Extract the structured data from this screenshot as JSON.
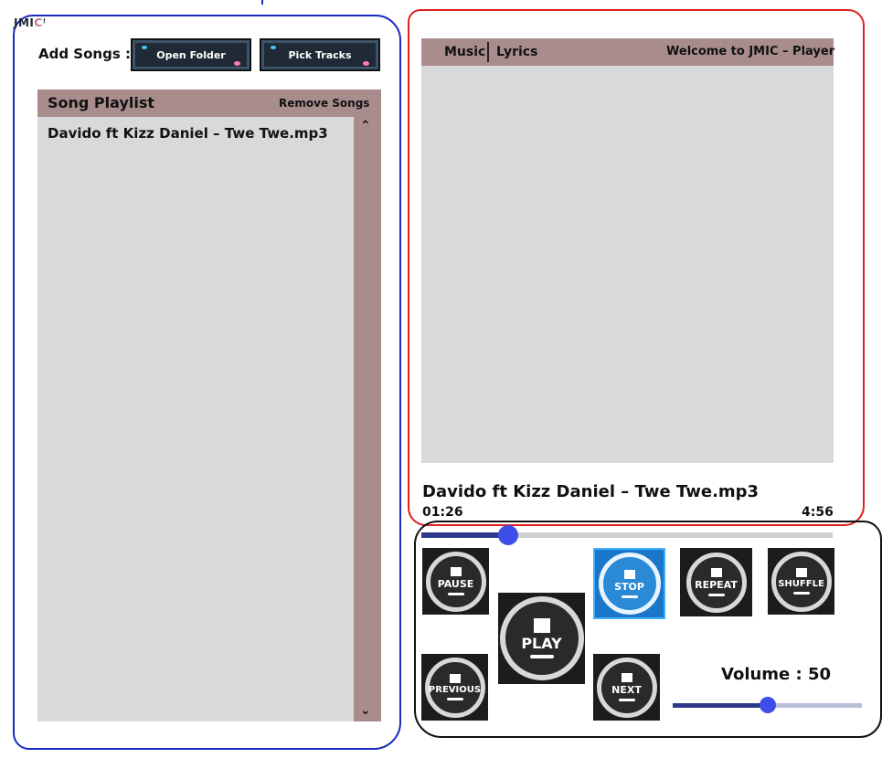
{
  "app": {
    "logo_prefix": "JMI",
    "logo_accent": "C"
  },
  "add_songs": {
    "label": "Add Songs :",
    "open_folder": "Open Folder",
    "pick_tracks": "Pick Tracks"
  },
  "playlist": {
    "title": "Song Playlist",
    "remove_label": "Remove Songs",
    "items": [
      "Davido ft Kizz Daniel – Twe Twe.mp3"
    ],
    "scroll_up": "^",
    "scroll_down": "v"
  },
  "right_panel": {
    "tab_music": "Music",
    "tab_lyrics": "Lyrics",
    "welcome": "Welcome to JMIC – Player"
  },
  "now_playing": {
    "title": "Davido ft Kizz Daniel – Twe Twe.mp3",
    "current_time": "01:26",
    "total_time": "4:56",
    "progress_fraction": 0.21
  },
  "controls": {
    "pause": "PAUSE",
    "stop": "STOP",
    "repeat": "REPEAT",
    "shuffle": "SHUFFLE",
    "play": "PLAY",
    "previous": "PREVIOUS",
    "next": "NEXT"
  },
  "volume": {
    "label": "Volume : 50",
    "value": 50
  },
  "colors": {
    "accent": "#a98d8d",
    "panel": "#d9d9d9",
    "slider": "#3d4fe8",
    "active": "#1976c8"
  }
}
